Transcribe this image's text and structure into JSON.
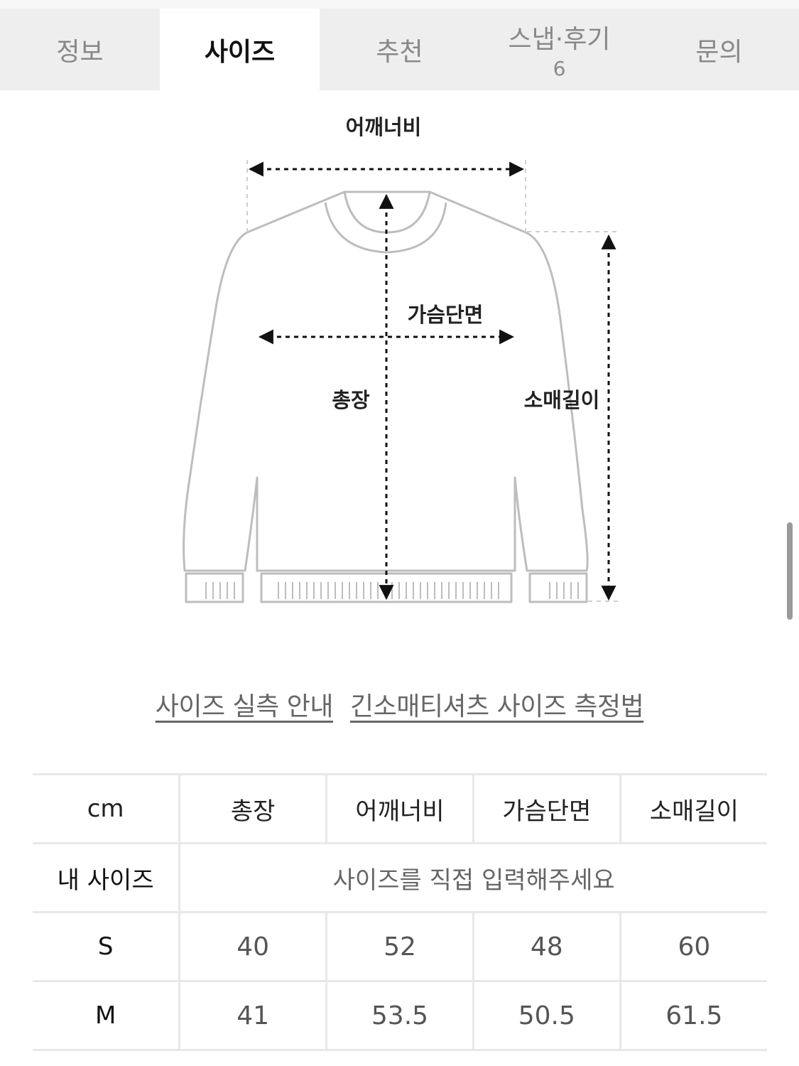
{
  "tabs": [
    {
      "label": "정보",
      "count": ""
    },
    {
      "label": "사이즈",
      "count": ""
    },
    {
      "label": "추천",
      "count": ""
    },
    {
      "label": "스냅·후기",
      "count": "6"
    },
    {
      "label": "문의",
      "count": ""
    }
  ],
  "active_tab": "사이즈",
  "diagram": {
    "shoulder_label": "어깨너비",
    "chest_label": "가슴단면",
    "length_label": "총장",
    "sleeve_label": "소매길이"
  },
  "guide_links": {
    "size_guide": "사이즈 실측 안내",
    "measure_method": "긴소매티셔츠 사이즈 측정법"
  },
  "size_table": {
    "unit": "cm",
    "columns": [
      "총장",
      "어깨너비",
      "가슴단면",
      "소매길이"
    ],
    "my_size_label": "내 사이즈",
    "my_size_placeholder": "사이즈를 직접 입력해주세요",
    "rows": [
      {
        "size": "S",
        "values": [
          "40",
          "52",
          "48",
          "60"
        ]
      },
      {
        "size": "M",
        "values": [
          "41",
          "53.5",
          "50.5",
          "61.5"
        ]
      }
    ]
  },
  "colors": {
    "tab_bar_bg": "#eeeeee",
    "active_tab_bg": "#ffffff",
    "outline": "#bdbdbd",
    "border": "#e8e8e8"
  }
}
